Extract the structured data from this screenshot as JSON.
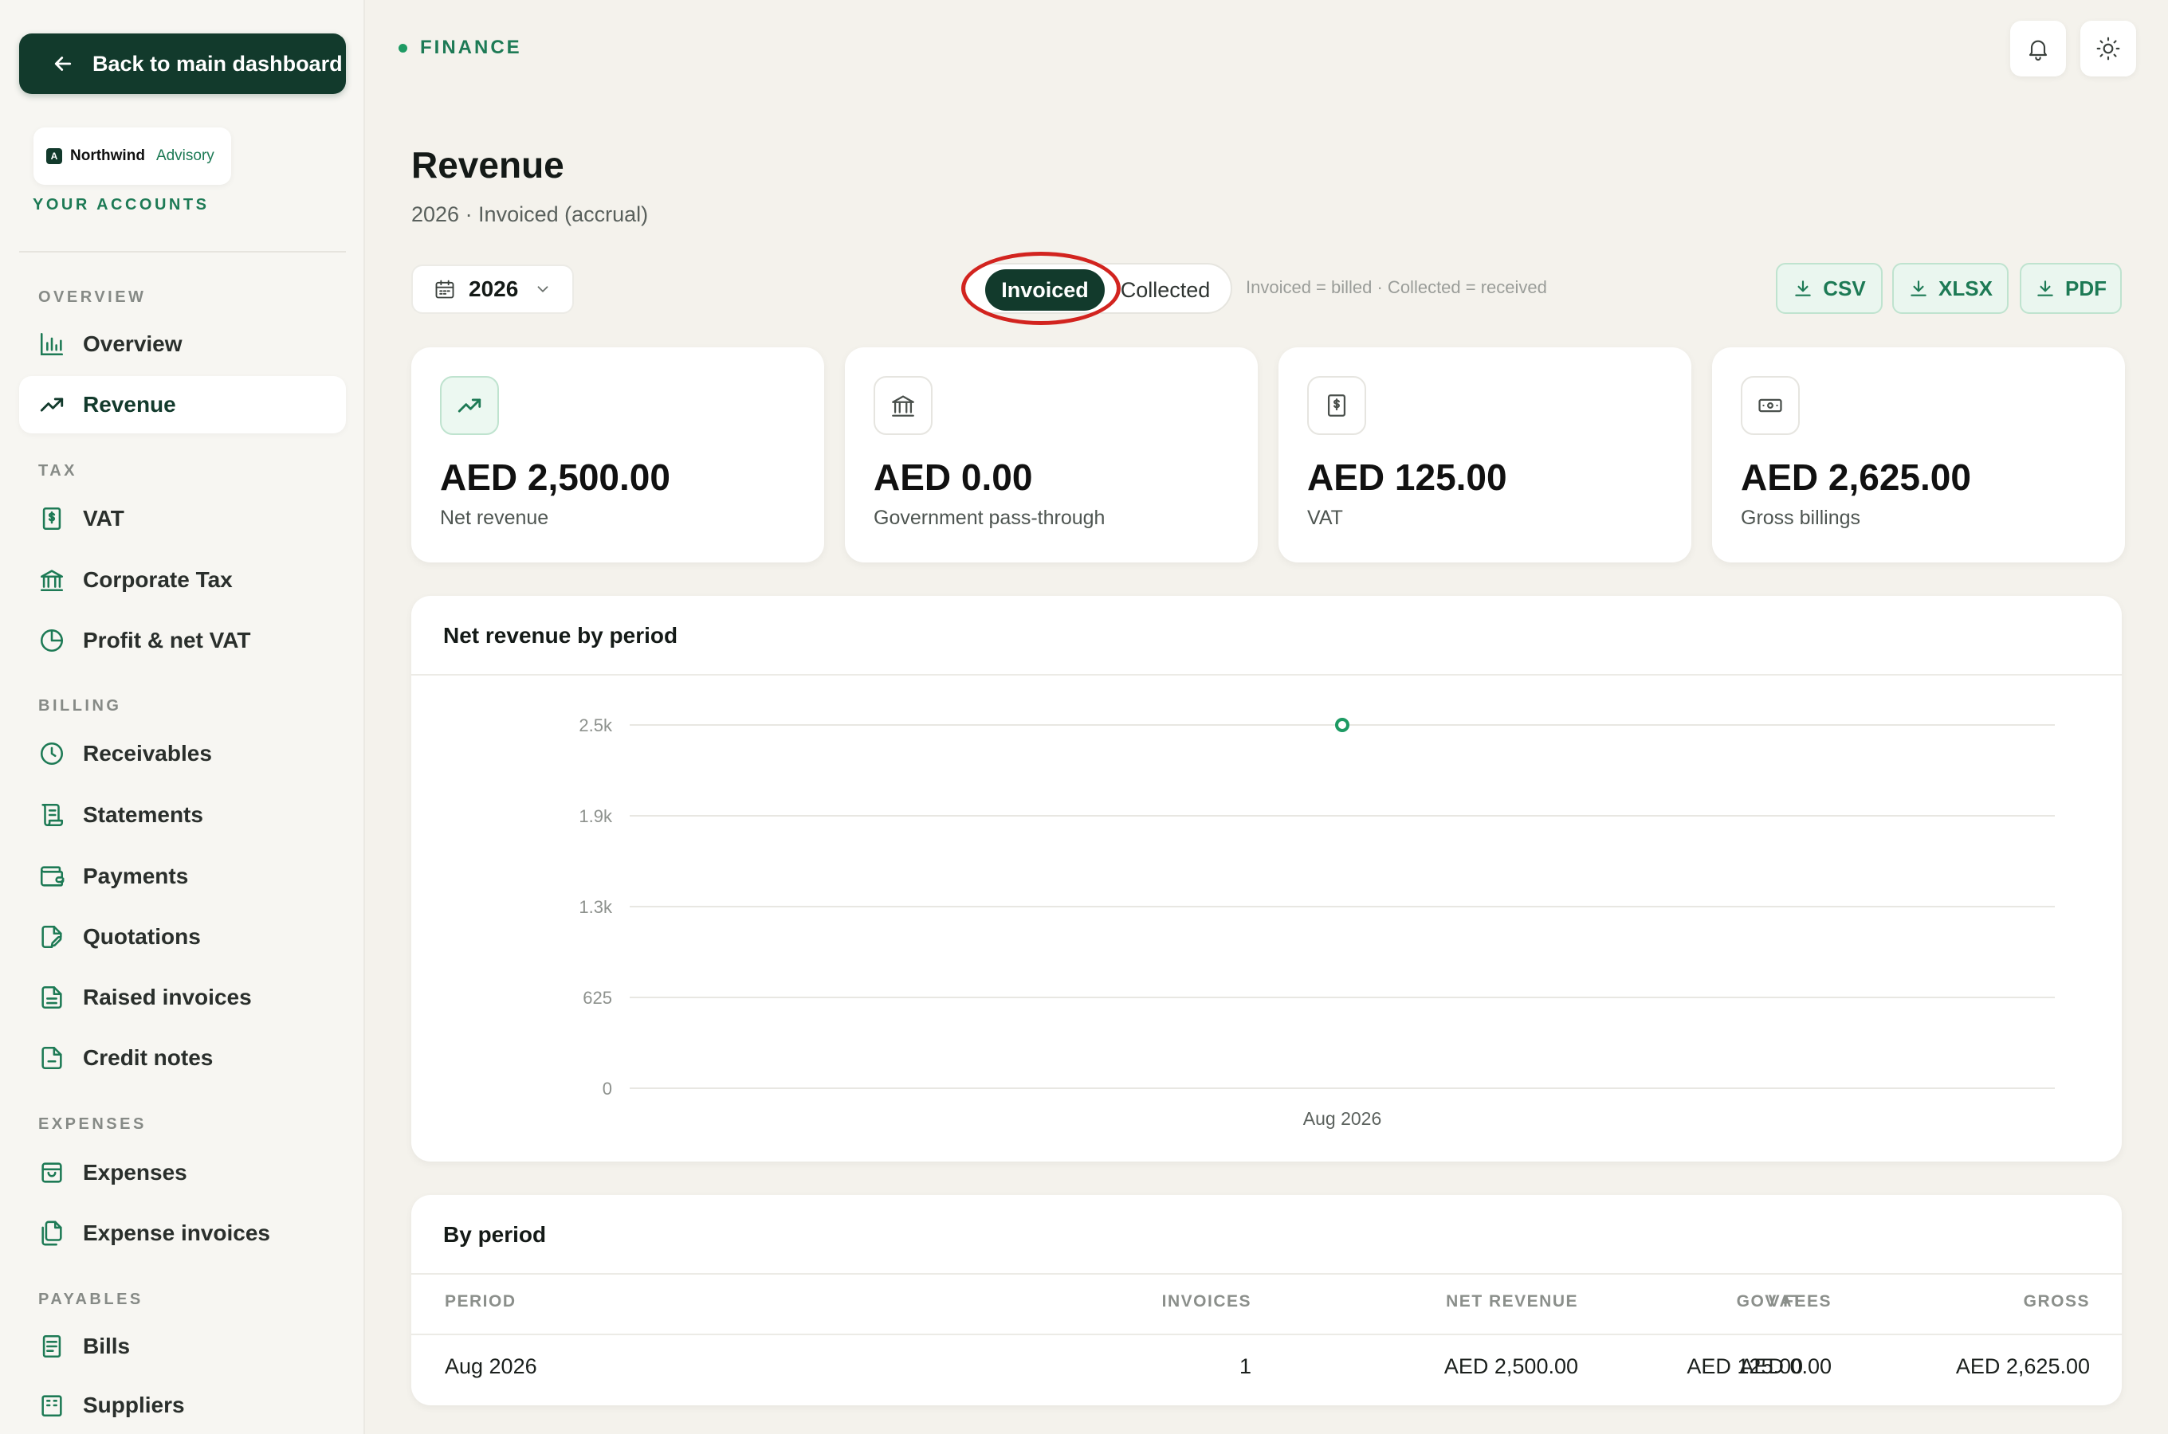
{
  "sidebar": {
    "back_label": "Back to main dashboard",
    "brand": {
      "mark": "A",
      "name": "Northwind",
      "sub": "Advisory"
    },
    "accounts_label": "YOUR ACCOUNTS",
    "sections": {
      "overview": "OVERVIEW",
      "tax": "TAX",
      "billing": "BILLING",
      "expenses": "EXPENSES",
      "payables": "PAYABLES"
    },
    "items": {
      "overview": "Overview",
      "revenue": "Revenue",
      "vat": "VAT",
      "corporate_tax": "Corporate Tax",
      "profit_net_vat": "Profit & net VAT",
      "receivables": "Receivables",
      "statements": "Statements",
      "payments": "Payments",
      "quotations": "Quotations",
      "raised_invoices": "Raised invoices",
      "credit_notes": "Credit notes",
      "expenses": "Expenses",
      "expense_invoices": "Expense invoices",
      "bills": "Bills",
      "suppliers": "Suppliers"
    },
    "active_item": "revenue"
  },
  "header": {
    "crumb": "FINANCE",
    "title": "Revenue",
    "subtitle": "2026 · Invoiced (accrual)"
  },
  "toolbar": {
    "year": "2026",
    "basis_options": [
      "Invoiced",
      "Collected"
    ],
    "basis_selected": "Invoiced",
    "hint": "Invoiced = billed · Collected = received",
    "exports": {
      "csv": "CSV",
      "xlsx": "XLSX",
      "pdf": "PDF"
    }
  },
  "kpis": [
    {
      "value": "AED 2,500.00",
      "label": "Net revenue",
      "icon": "trending-up-icon"
    },
    {
      "value": "AED 0.00",
      "label": "Government pass-through",
      "icon": "bank-icon"
    },
    {
      "value": "AED 125.00",
      "label": "VAT",
      "icon": "receipt-icon"
    },
    {
      "value": "AED 2,625.00",
      "label": "Gross billings",
      "icon": "banknote-icon"
    }
  ],
  "chart_panel": {
    "title": "Net revenue by period"
  },
  "chart_data": {
    "type": "line",
    "title": "Net revenue by period",
    "categories": [
      "Aug 2026"
    ],
    "series": [
      {
        "values": [
          2500
        ]
      }
    ],
    "y_ticks": [
      "0",
      "625",
      "1.3k",
      "1.9k",
      "2.5k"
    ],
    "ylim": [
      0,
      2500
    ],
    "grid": true
  },
  "table_panel": {
    "title": "By period",
    "columns": [
      "PERIOD",
      "INVOICES",
      "NET REVENUE",
      "GOV FEES",
      "VAT",
      "GROSS"
    ],
    "rows": [
      [
        "Aug 2026",
        "1",
        "AED 2,500.00",
        "AED 0.00",
        "AED 125.00",
        "AED 2,625.00"
      ]
    ]
  },
  "colors": {
    "brand_dark": "#123a2c",
    "accent_green": "#1d7a55",
    "chart_point": "#1d9a63",
    "annotation_red": "#d2241f"
  }
}
